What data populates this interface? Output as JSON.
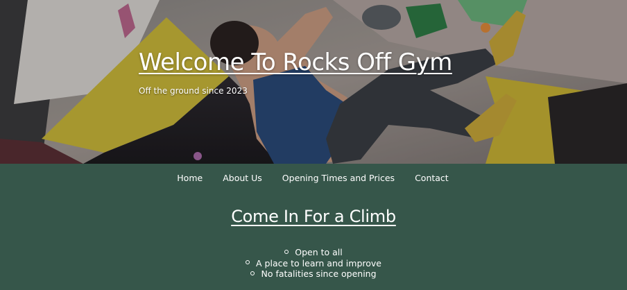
{
  "hero": {
    "title": "Welcome To Rocks Off Gym",
    "subtitle": "Off the ground since 2023",
    "image_alt": "climber-on-bouldering-wall-photo"
  },
  "nav": {
    "items": [
      {
        "label": "Home"
      },
      {
        "label": "About Us"
      },
      {
        "label": "Opening Times and Prices"
      },
      {
        "label": "Contact"
      }
    ]
  },
  "main": {
    "section_title": "Come In For a Climb",
    "features": [
      {
        "text": "Open to all"
      },
      {
        "text": "A place to learn and improve"
      },
      {
        "text": "No fatalities since opening"
      }
    ]
  },
  "colors": {
    "page_background": "#36564a",
    "text": "#ffffff",
    "hold_yellow": "#d9c43a",
    "climber_top": "#2a4a78"
  }
}
